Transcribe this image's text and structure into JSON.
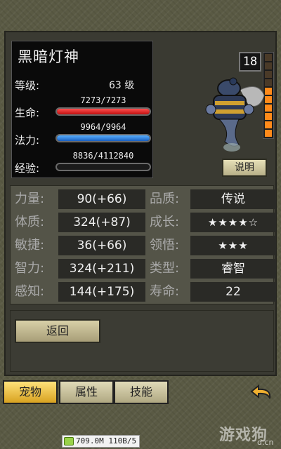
{
  "pet": {
    "name": "黑暗灯神",
    "level_label": "等级:",
    "level_value": "63 级",
    "hp_label": "生命:",
    "hp_text": "7273/7273",
    "hp_fraction": 1.0,
    "mp_label": "法力:",
    "mp_text": "9964/9964",
    "mp_fraction": 1.0,
    "exp_label": "经验:",
    "exp_text": "8836/4112840",
    "exp_fraction": 0.002,
    "level_badge": "18",
    "meter_total": 10,
    "meter_on": 6,
    "describe_button": "说明"
  },
  "stats": {
    "rows": [
      {
        "l1": "力量:",
        "v1": "90(+66)",
        "l2": "品质:",
        "v2": "传说"
      },
      {
        "l1": "体质:",
        "v1": "324(+87)",
        "l2": "成长:",
        "v2": "★★★★☆"
      },
      {
        "l1": "敏捷:",
        "v1": "36(+66)",
        "l2": "领悟:",
        "v2": "★★★"
      },
      {
        "l1": "智力:",
        "v1": "324(+211)",
        "l2": "类型:",
        "v2": "睿智"
      },
      {
        "l1": "感知:",
        "v1": "144(+175)",
        "l2": "寿命:",
        "v2": "22"
      }
    ]
  },
  "back_button": "返回",
  "tabs": {
    "pet": "宠物",
    "attr": "属性",
    "skill": "技能"
  },
  "status": {
    "text": "709.0M 110B/5"
  },
  "watermark": {
    "main": "游戏狗",
    "sub": "d.cn"
  },
  "colors": {
    "hp": "#d81818",
    "mp": "#2a7ad8",
    "exp": "#3a9a3a",
    "active_tab": "#f0c040",
    "meter_on": "#ff8a1a"
  }
}
